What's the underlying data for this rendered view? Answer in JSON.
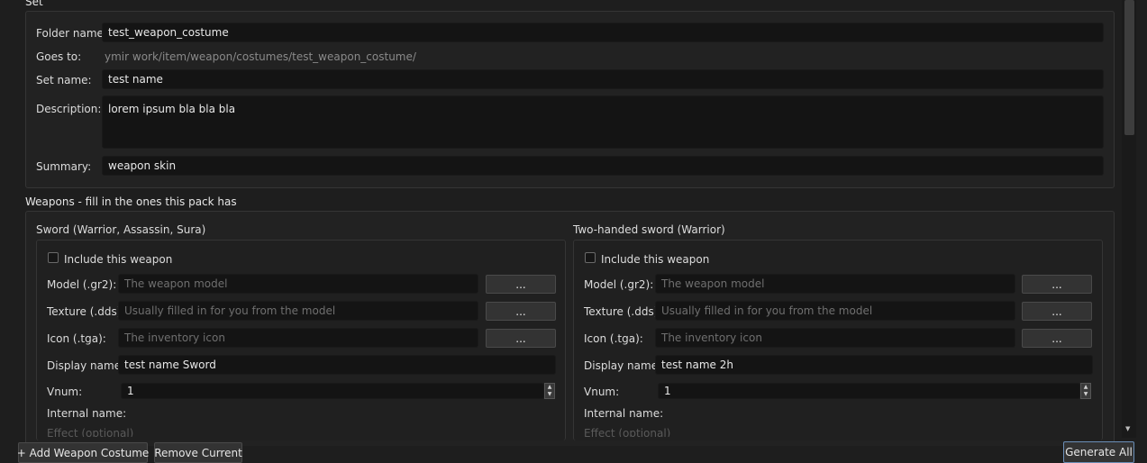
{
  "set": {
    "title": "Set",
    "folder_label": "Folder name:",
    "folder_value": "test_weapon_costume",
    "goes_to_label": "Goes to:",
    "goes_to_value": "ymir work/item/weapon/costumes/test_weapon_costume/",
    "set_name_label": "Set name:",
    "set_name_value": "test name",
    "description_label": "Description:",
    "description_value": "lorem ipsum bla bla bla",
    "summary_label": "Summary:",
    "summary_value": "weapon skin"
  },
  "weapons": {
    "title": "Weapons - fill in the ones this pack has",
    "cards": [
      {
        "title": "Sword (Warrior, Assassin, Sura)",
        "include_label": "Include this weapon",
        "include_checked": false,
        "model_label": "Model (.gr2):",
        "model_placeholder": "The weapon model",
        "texture_label": "Texture (.dds):",
        "texture_placeholder": "Usually filled in for you from the model",
        "icon_label": "Icon (.tga):",
        "icon_placeholder": "The inventory icon",
        "browse_label": "...",
        "display_label": "Display name:",
        "display_value": "test name Sword",
        "vnum_label": "Vnum:",
        "vnum_value": "1",
        "internal_label": "Internal name:",
        "effect_label": "Effect (optional)"
      },
      {
        "title": "Two-handed sword (Warrior)",
        "include_label": "Include this weapon",
        "include_checked": false,
        "model_label": "Model (.gr2):",
        "model_placeholder": "The weapon model",
        "texture_label": "Texture (.dds):",
        "texture_placeholder": "Usually filled in for you from the model",
        "icon_label": "Icon (.tga):",
        "icon_placeholder": "The inventory icon",
        "browse_label": "...",
        "display_label": "Display name:",
        "display_value": "test name 2h",
        "vnum_label": "Vnum:",
        "vnum_value": "1",
        "internal_label": "Internal name:",
        "effect_label": "Effect (optional)"
      }
    ]
  },
  "footer": {
    "add_label": "+ Add Weapon Costume",
    "remove_label": "Remove Current",
    "generate_label": "Generate All"
  }
}
